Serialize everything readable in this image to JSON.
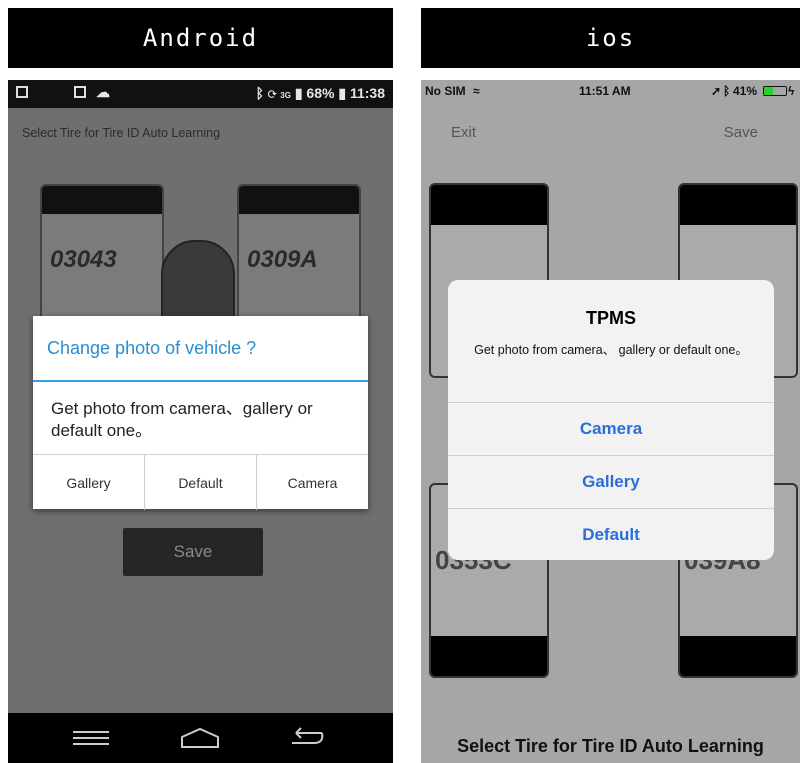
{
  "headers": {
    "android": "Android",
    "ios": "ios"
  },
  "android": {
    "status": {
      "battery": "68%",
      "time": "11:38",
      "network": "3G"
    },
    "title": "Select Tire for Tire ID Auto Learning",
    "tires": {
      "front_left": "03043",
      "front_right": "0309A"
    },
    "dialog": {
      "title": "Change photo of vehicle ?",
      "message": "Get photo from camera、gallery or default one。",
      "buttons": [
        "Gallery",
        "Default",
        "Camera"
      ]
    },
    "save_label": "Save",
    "colors": {
      "accent": "#34a0e0"
    }
  },
  "ios": {
    "status": {
      "carrier": "No SIM",
      "time": "11:51 AM",
      "battery": "41%"
    },
    "exit_label": "Exit",
    "save_label": "Save",
    "tires": {
      "rear_left": "0353C",
      "rear_right": "039A8"
    },
    "dialog": {
      "title": "TPMS",
      "message": "Get photo from camera、 gallery or default one。",
      "buttons": [
        "Camera",
        "Gallery",
        "Default"
      ]
    },
    "footer": "Select Tire for Tire ID Auto Learning",
    "colors": {
      "accent": "#2a6fd8"
    }
  }
}
